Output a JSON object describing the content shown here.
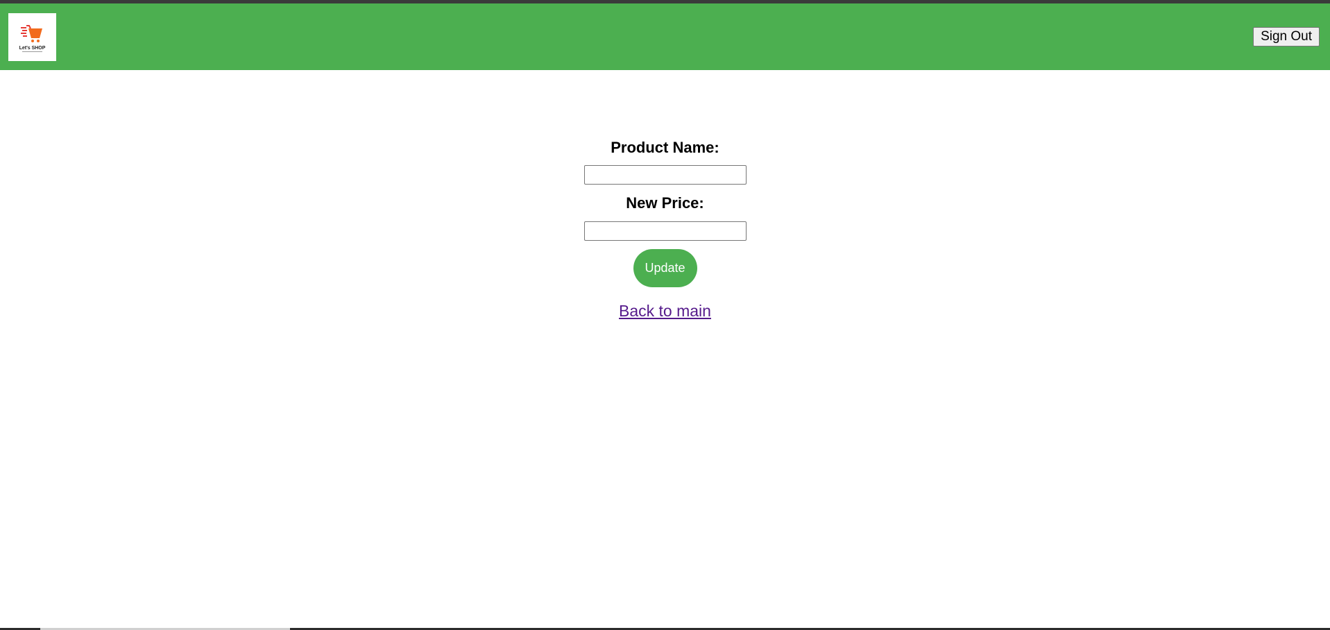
{
  "header": {
    "logo_text": "Let's SHOP",
    "signout_label": "Sign Out",
    "background_color": "#4caf50"
  },
  "form": {
    "product_name_label": "Product Name:",
    "product_name_value": "",
    "new_price_label": "New Price:",
    "new_price_value": "",
    "update_label": "Update",
    "back_link_label": "Back to main"
  },
  "colors": {
    "accent": "#4caf50",
    "visited_link": "#551a8b"
  }
}
